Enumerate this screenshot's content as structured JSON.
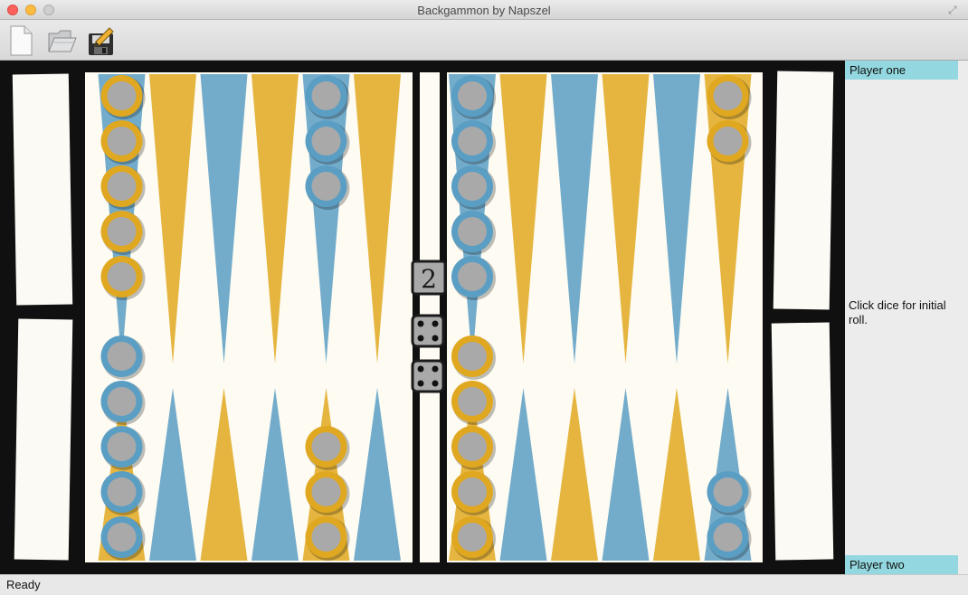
{
  "window": {
    "title": "Backgammon by Napszel"
  },
  "toolbar": {
    "buttons": [
      {
        "name": "new-game-button",
        "icon": "new-document-icon"
      },
      {
        "name": "open-game-button",
        "icon": "folder-open-icon"
      },
      {
        "name": "save-game-button",
        "icon": "floppy-save-icon"
      }
    ]
  },
  "colors": {
    "blue": "#5b9ec4",
    "gold": "#e0a820",
    "board": "#fdfbf2",
    "frame": "#101010",
    "checker_center": "#a9a9a9",
    "panel_highlight": "#93d8e0"
  },
  "board": {
    "dice": {
      "doubling_cube": "2"
    },
    "top_half": [
      {
        "point": 12,
        "checkers": 5,
        "checker_color": "gold"
      },
      {
        "point": 11,
        "checkers": 0
      },
      {
        "point": 10,
        "checkers": 0
      },
      {
        "point": 9,
        "checkers": 0
      },
      {
        "point": 8,
        "checkers": 3,
        "checker_color": "blue"
      },
      {
        "point": 7,
        "checkers": 0
      },
      {
        "point": 6,
        "checkers": 5,
        "checker_color": "blue"
      },
      {
        "point": 5,
        "checkers": 0
      },
      {
        "point": 4,
        "checkers": 0
      },
      {
        "point": 3,
        "checkers": 0
      },
      {
        "point": 2,
        "checkers": 0
      },
      {
        "point": 1,
        "checkers": 2,
        "checker_color": "gold"
      }
    ],
    "bottom_half": [
      {
        "point": 13,
        "checkers": 5,
        "checker_color": "blue"
      },
      {
        "point": 14,
        "checkers": 0
      },
      {
        "point": 15,
        "checkers": 0
      },
      {
        "point": 16,
        "checkers": 0
      },
      {
        "point": 17,
        "checkers": 3,
        "checker_color": "gold"
      },
      {
        "point": 18,
        "checkers": 0
      },
      {
        "point": 19,
        "checkers": 5,
        "checker_color": "gold"
      },
      {
        "point": 20,
        "checkers": 0
      },
      {
        "point": 21,
        "checkers": 0
      },
      {
        "point": 22,
        "checkers": 0
      },
      {
        "point": 23,
        "checkers": 0
      },
      {
        "point": 24,
        "checkers": 2,
        "checker_color": "blue"
      }
    ]
  },
  "side_panel": {
    "player_one": "Player one",
    "message": "Click dice for initial roll.",
    "player_two": "Player two"
  },
  "status": {
    "text": "Ready"
  }
}
